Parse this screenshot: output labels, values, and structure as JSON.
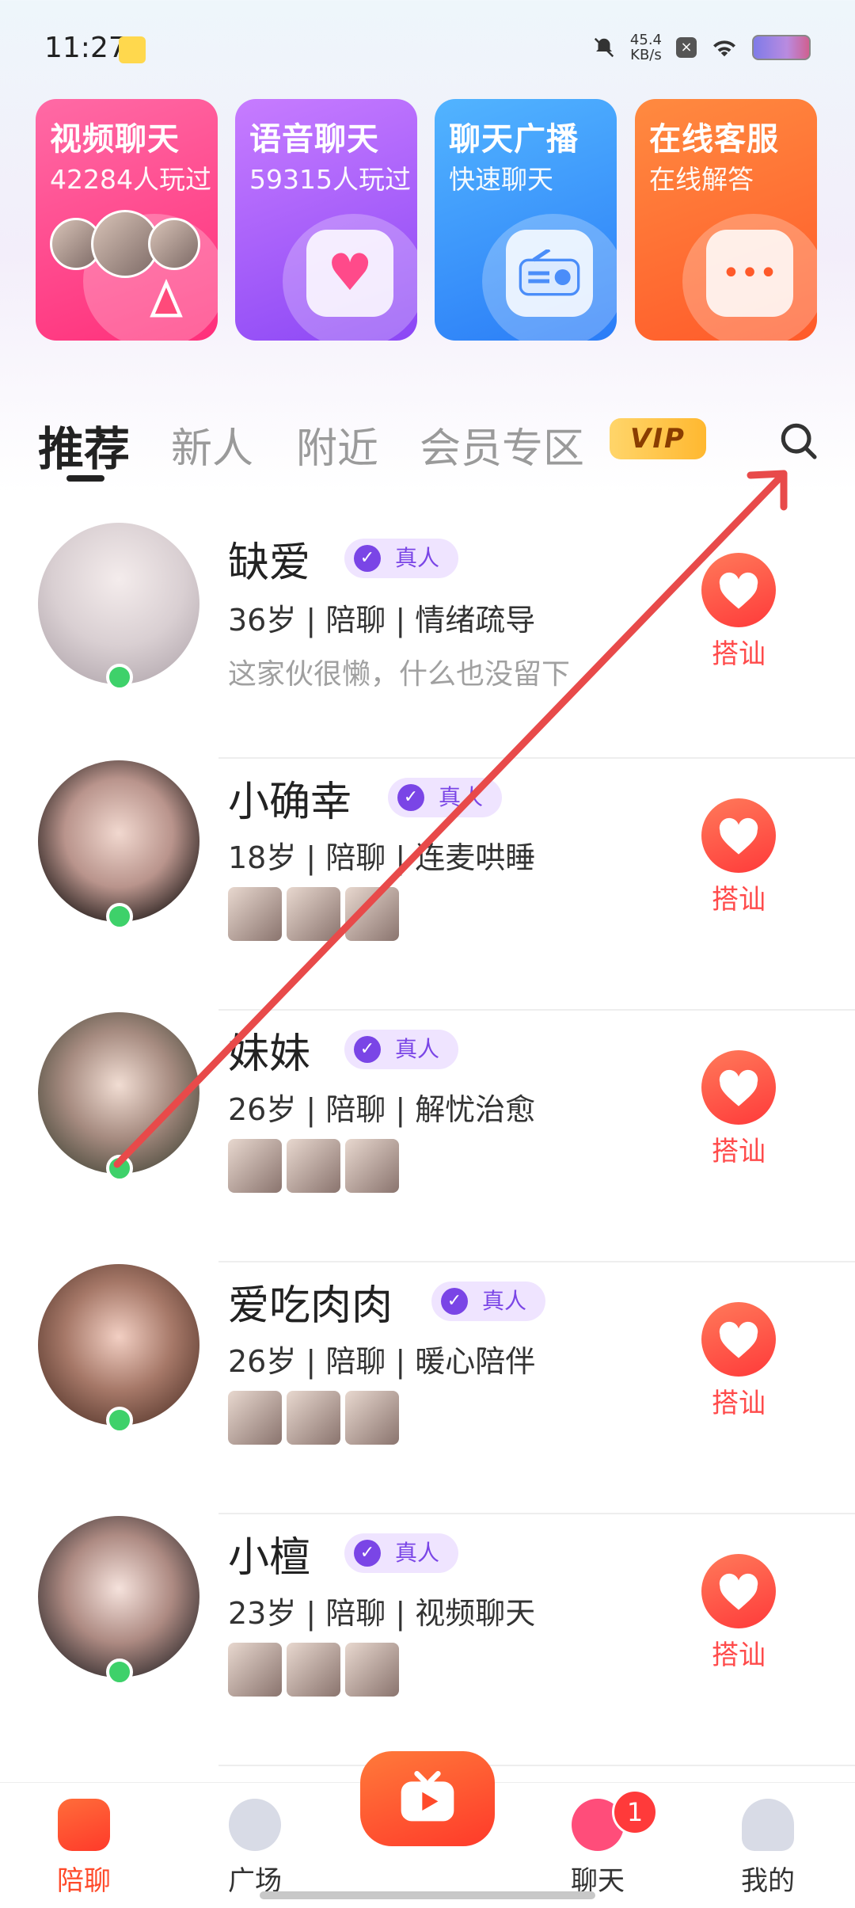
{
  "status_bar": {
    "time": "11:27",
    "net_speed_value": "45.4",
    "net_speed_unit": "KB/s"
  },
  "feature_cards": [
    {
      "title": "视频聊天",
      "subtitle": "42284人玩过",
      "color": "#ff3f86"
    },
    {
      "title": "语音聊天",
      "subtitle": "59315人玩过",
      "color": "#9a55f7"
    },
    {
      "title": "聊天广播",
      "subtitle": "快速聊天",
      "color": "#3b8ff9"
    },
    {
      "title": "在线客服",
      "subtitle": "在线解答",
      "color": "#ff6a33"
    }
  ],
  "tabs": {
    "items": [
      "推荐",
      "新人",
      "附近",
      "会员专区"
    ],
    "active": "推荐",
    "vip_label": "VIP"
  },
  "users": [
    {
      "name": "缺爱",
      "verified": "真人",
      "info": "36岁 | 陪聊 | 情绪疏导",
      "bio": "这家伙很懒，什么也没留下",
      "greet": "搭讪"
    },
    {
      "name": "小确幸",
      "verified": "真人",
      "info": "18岁 | 陪聊 | 连麦哄睡",
      "greet": "搭讪"
    },
    {
      "name": "妹妹",
      "verified": "真人",
      "info": "26岁 | 陪聊 | 解忧治愈",
      "greet": "搭讪"
    },
    {
      "name": "爱吃肉肉",
      "verified": "真人",
      "info": "26岁 | 陪聊 | 暖心陪伴",
      "greet": "搭讪"
    },
    {
      "name": "小檀",
      "verified": "真人",
      "info": "23岁 | 陪聊 | 视频聊天",
      "greet": "搭讪"
    }
  ],
  "bottom_nav": {
    "items": [
      "陪聊",
      "广场",
      "聊天",
      "我的"
    ],
    "active": "陪聊",
    "chat_badge": "1"
  },
  "colors": {
    "accent": "#ff4a2a",
    "verified": "#7a45e6",
    "online": "#3ed16a",
    "annotation_arrow": "#e84a4a"
  }
}
